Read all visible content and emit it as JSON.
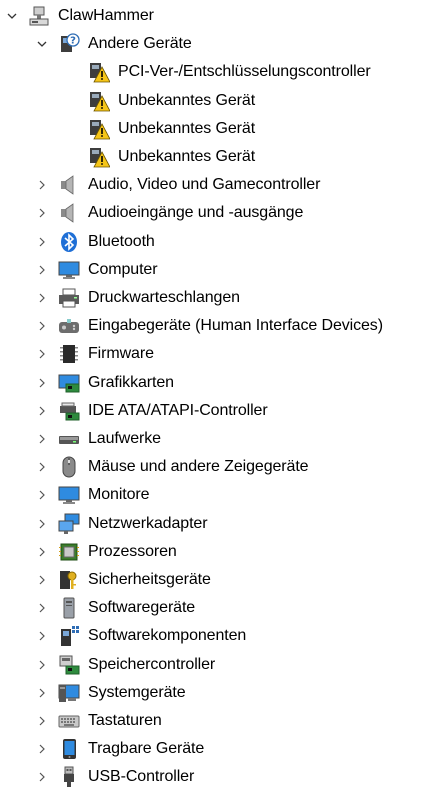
{
  "root": {
    "label": "ClawHammer",
    "icon": "computer-root-icon",
    "expanded": true
  },
  "expanded_group": {
    "label": "Andere Geräte",
    "icon": "unknown-device-icon",
    "expanded": true,
    "children": [
      {
        "label": "PCI-Ver-/Entschlüsselungscontroller",
        "icon": "warning-device-icon"
      },
      {
        "label": "Unbekanntes Gerät",
        "icon": "warning-device-icon"
      },
      {
        "label": "Unbekanntes Gerät",
        "icon": "warning-device-icon"
      },
      {
        "label": "Unbekanntes Gerät",
        "icon": "warning-device-icon"
      }
    ]
  },
  "categories": [
    {
      "label": "Audio, Video und Gamecontroller",
      "icon": "speaker-icon"
    },
    {
      "label": "Audioeingänge und -ausgänge",
      "icon": "speaker-icon"
    },
    {
      "label": "Bluetooth",
      "icon": "bluetooth-icon"
    },
    {
      "label": "Computer",
      "icon": "monitor-icon"
    },
    {
      "label": "Druckwarteschlangen",
      "icon": "printer-icon"
    },
    {
      "label": "Eingabegeräte (Human Interface Devices)",
      "icon": "hid-icon"
    },
    {
      "label": "Firmware",
      "icon": "chip-icon"
    },
    {
      "label": "Grafikkarten",
      "icon": "display-adapter-icon"
    },
    {
      "label": "IDE ATA/ATAPI-Controller",
      "icon": "ide-controller-icon"
    },
    {
      "label": "Laufwerke",
      "icon": "drive-icon"
    },
    {
      "label": "Mäuse und andere Zeigegeräte",
      "icon": "mouse-icon"
    },
    {
      "label": "Monitore",
      "icon": "monitor-icon"
    },
    {
      "label": "Netzwerkadapter",
      "icon": "network-icon"
    },
    {
      "label": "Prozessoren",
      "icon": "processor-icon"
    },
    {
      "label": "Sicherheitsgeräte",
      "icon": "security-key-icon"
    },
    {
      "label": "Softwaregeräte",
      "icon": "software-device-icon"
    },
    {
      "label": "Softwarekomponenten",
      "icon": "software-component-icon"
    },
    {
      "label": "Speichercontroller",
      "icon": "storage-controller-icon"
    },
    {
      "label": "Systemgeräte",
      "icon": "system-device-icon"
    },
    {
      "label": "Tastaturen",
      "icon": "keyboard-icon"
    },
    {
      "label": "Tragbare Geräte",
      "icon": "portable-device-icon"
    },
    {
      "label": "USB-Controller",
      "icon": "usb-icon"
    }
  ]
}
